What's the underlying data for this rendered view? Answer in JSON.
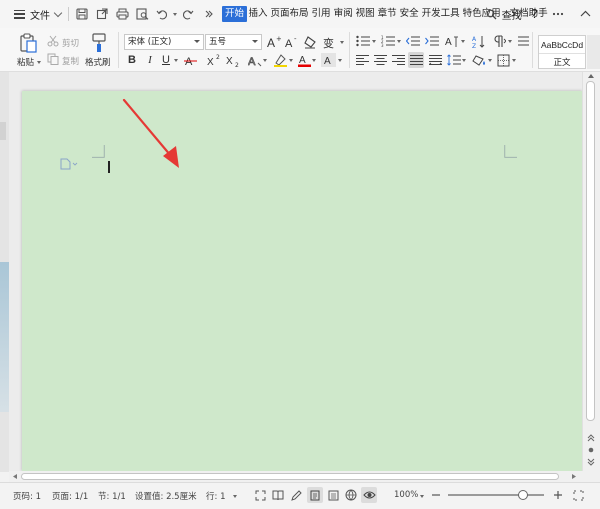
{
  "menubar": {
    "file_label": "文件",
    "tabs": [
      {
        "label": "开始",
        "active": true
      },
      {
        "label": "插入"
      },
      {
        "label": "页面布局"
      },
      {
        "label": "引用"
      },
      {
        "label": "审阅"
      },
      {
        "label": "视图"
      },
      {
        "label": "章节"
      },
      {
        "label": "安全"
      },
      {
        "label": "开发工具"
      },
      {
        "label": "特色应用"
      },
      {
        "label": "文档助手"
      }
    ],
    "search_label": "查找",
    "help_label": "?"
  },
  "ribbon": {
    "paste_label": "粘贴",
    "cut_label": "剪切",
    "copy_label": "复制",
    "format_painter_label": "格式刷",
    "font_name": "宋体 (正文)",
    "font_size": "五号",
    "style_preview": "AaBbCcDd",
    "style_name": "正文"
  },
  "statusbar": {
    "page_no": "页码: 1",
    "pages": "页面: 1/1",
    "section": "节: 1/1",
    "setting": "设置值: 2.5厘米",
    "row": "行: 1",
    "zoom": "100%",
    "zoom_fraction": 0.78
  },
  "colors": {
    "accent": "#2b6fd8",
    "page_background": "#cfe8cb",
    "arrow": "#e53935",
    "font_color_bar": "#e60000"
  },
  "icons": [
    "menu-icon",
    "save-icon",
    "export-icon",
    "print-icon",
    "print-preview-icon",
    "undo-icon",
    "redo-icon",
    "search-icon",
    "help-icon",
    "settings-icon",
    "minimize-icon",
    "paste-icon",
    "cut-icon",
    "copy-icon",
    "format-painter-icon",
    "bold-icon",
    "italic-icon",
    "underline-icon",
    "strikethrough-icon",
    "superscript-icon",
    "subscript-icon",
    "font-color-icon",
    "highlight-icon",
    "grow-font-icon",
    "shrink-font-icon",
    "clear-format-icon",
    "phonetic-icon",
    "bullets-icon",
    "numbering-icon",
    "outdent-icon",
    "indent-icon",
    "align-left-icon",
    "align-center-icon",
    "align-right-icon",
    "justify-icon",
    "line-spacing-icon",
    "shading-icon",
    "borders-icon",
    "sort-icon",
    "show-marks-icon",
    "document-icon",
    "arrow-annotation"
  ]
}
